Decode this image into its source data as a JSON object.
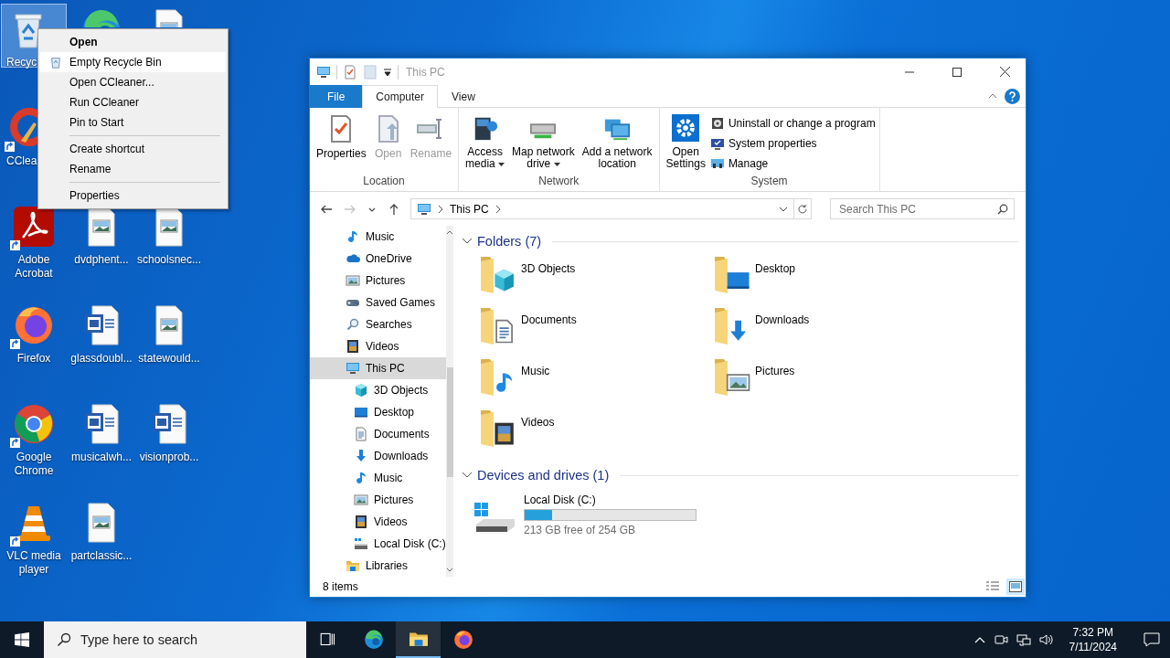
{
  "desktop": {
    "rows": [
      [
        {
          "kind": "recycle-bin",
          "label": "Recycl",
          "selected": true,
          "shortcut": false
        },
        {
          "kind": "edge",
          "selected": false
        },
        {
          "kind": "image-file",
          "selected": false
        }
      ],
      [
        {
          "kind": "ccleaner",
          "label": "CClea",
          "selected": false,
          "shortcut": true
        }
      ],
      [
        {
          "kind": "acrobat",
          "label": "Adobe Acrobat",
          "selected": false,
          "shortcut": true
        },
        {
          "kind": "image-file",
          "label": "dvdphent...",
          "selected": false,
          "shortcut": false
        },
        {
          "kind": "image-file",
          "label": "schoolsnec...",
          "selected": false,
          "shortcut": false
        }
      ],
      [
        {
          "kind": "firefox",
          "label": "Firefox",
          "selected": false,
          "shortcut": true
        },
        {
          "kind": "word-file",
          "label": "glassdoubl...",
          "selected": false,
          "shortcut": false
        },
        {
          "kind": "image-file",
          "label": "statewould...",
          "selected": false,
          "shortcut": false
        }
      ],
      [
        {
          "kind": "chrome",
          "label": "Google Chrome",
          "selected": false,
          "shortcut": true
        },
        {
          "kind": "word-file",
          "label": "musicalwh...",
          "selected": false,
          "shortcut": false
        },
        {
          "kind": "word-file",
          "label": "visionprob...",
          "selected": false,
          "shortcut": false
        }
      ],
      [
        {
          "kind": "vlc",
          "label": "VLC media player",
          "selected": false,
          "shortcut": true
        },
        {
          "kind": "image-file",
          "label": "partclassic...",
          "selected": false,
          "shortcut": false
        }
      ]
    ]
  },
  "context_menu": {
    "items": [
      {
        "kind": "item",
        "label": "Open",
        "default": true,
        "selected": false,
        "has_icon": false
      },
      {
        "kind": "item",
        "label": "Empty Recycle Bin",
        "default": false,
        "selected": true,
        "has_icon": true
      },
      {
        "kind": "item",
        "label": "Open CCleaner...",
        "default": false,
        "selected": false,
        "has_icon": false
      },
      {
        "kind": "item",
        "label": "Run CCleaner",
        "default": false,
        "selected": false,
        "has_icon": false
      },
      {
        "kind": "item",
        "label": "Pin to Start",
        "default": false,
        "selected": false,
        "has_icon": false
      },
      {
        "kind": "separator"
      },
      {
        "kind": "item",
        "label": "Create shortcut",
        "default": false,
        "selected": false,
        "has_icon": false
      },
      {
        "kind": "item",
        "label": "Rename",
        "default": false,
        "selected": false,
        "has_icon": false
      },
      {
        "kind": "separator"
      },
      {
        "kind": "item",
        "label": "Properties",
        "default": false,
        "selected": false,
        "has_icon": false
      }
    ]
  },
  "explorer": {
    "title": "This PC",
    "tabs": [
      {
        "kind": "file",
        "label": "File",
        "selected": false
      },
      {
        "kind": "tab",
        "label": "Computer",
        "selected": true
      },
      {
        "kind": "tab",
        "label": "View",
        "selected": false
      }
    ],
    "ribbon": {
      "groups": [
        {
          "label": "Location",
          "buttons": [
            {
              "kind": "large",
              "label": "Properties",
              "disabled": false,
              "dropdown": false
            },
            {
              "kind": "large",
              "label": "Open",
              "disabled": true,
              "dropdown": false
            },
            {
              "kind": "large",
              "label": "Rename",
              "disabled": true,
              "dropdown": false
            }
          ]
        },
        {
          "label": "Network",
          "buttons": [
            {
              "kind": "large",
              "label": "Access\nmedia",
              "disabled": false,
              "dropdown": true
            },
            {
              "kind": "large",
              "label": "Map network\ndrive",
              "disabled": false,
              "dropdown": true
            },
            {
              "kind": "large",
              "label": "Add a network\nlocation",
              "disabled": false,
              "dropdown": false
            }
          ]
        },
        {
          "label": "System",
          "buttons": [
            {
              "kind": "large",
              "label": "Open\nSettings",
              "disabled": false,
              "dropdown": false
            },
            {
              "kind": "small",
              "label": "Uninstall or change a program",
              "disabled": false
            },
            {
              "kind": "small",
              "label": "System properties",
              "disabled": false
            },
            {
              "kind": "small",
              "label": "Manage",
              "disabled": false
            }
          ]
        }
      ]
    },
    "nav_buttons": [
      {
        "kind": "back",
        "disabled": false
      },
      {
        "kind": "forward",
        "disabled": true
      },
      {
        "kind": "recent",
        "disabled": false
      },
      {
        "kind": "up",
        "disabled": false
      }
    ],
    "address": {
      "crumbs": [
        "This PC"
      ]
    },
    "search": {
      "placeholder": "Search This PC"
    },
    "tree": [
      {
        "children": [
          {
            "kind": "music",
            "label": "Music",
            "selected": false
          },
          {
            "kind": "onedrive",
            "label": "OneDrive",
            "selected": false
          },
          {
            "kind": "pictures",
            "label": "Pictures",
            "selected": false
          },
          {
            "kind": "games",
            "label": "Saved Games",
            "selected": false
          },
          {
            "kind": "search",
            "label": "Searches",
            "selected": false
          },
          {
            "kind": "videos",
            "label": "Videos",
            "selected": false
          }
        ]
      },
      {
        "kind": "pc",
        "label": "This PC",
        "selected": true,
        "children": [
          {
            "kind": "objects",
            "label": "3D Objects",
            "selected": false
          },
          {
            "kind": "desktop",
            "label": "Desktop",
            "selected": false
          },
          {
            "kind": "documents",
            "label": "Documents",
            "selected": false
          },
          {
            "kind": "downloads",
            "label": "Downloads",
            "selected": false
          },
          {
            "kind": "music",
            "label": "Music",
            "selected": false
          },
          {
            "kind": "pictures",
            "label": "Pictures",
            "selected": false
          },
          {
            "kind": "videos",
            "label": "Videos",
            "selected": false
          },
          {
            "kind": "disk",
            "label": "Local Disk (C:)",
            "selected": false
          }
        ]
      },
      {
        "kind": "libraries",
        "label": "Libraries",
        "selected": false
      }
    ],
    "content": {
      "groups": [
        {
          "title": "Folders (7)",
          "expanded": true,
          "folders": [
            {
              "kind": "objects",
              "label": "3D Objects"
            },
            {
              "kind": "desktop",
              "label": "Desktop"
            },
            {
              "kind": "documents",
              "label": "Documents"
            },
            {
              "kind": "downloads",
              "label": "Downloads"
            },
            {
              "kind": "music",
              "label": "Music"
            },
            {
              "kind": "pictures",
              "label": "Pictures"
            },
            {
              "kind": "videos",
              "label": "Videos"
            }
          ]
        },
        {
          "title": "Devices and drives (1)",
          "expanded": true,
          "drives": [
            {
              "label": "Local Disk (C:)",
              "level": 0.16,
              "reading": "213 GB free of 254 GB"
            }
          ]
        }
      ]
    },
    "status": "8 items",
    "views": [
      {
        "kind": "details",
        "selected": false
      },
      {
        "kind": "large-icons",
        "selected": true
      }
    ]
  },
  "taskbar": {
    "search": {
      "placeholder": "Type here to search"
    },
    "apps": [
      {
        "kind": "task-view",
        "running": false
      },
      {
        "kind": "edge",
        "running": false
      },
      {
        "kind": "explorer",
        "running": true
      },
      {
        "kind": "firefox",
        "running": false
      }
    ],
    "clock": {
      "time": "7:32 PM",
      "date": "7/11/2024"
    }
  }
}
